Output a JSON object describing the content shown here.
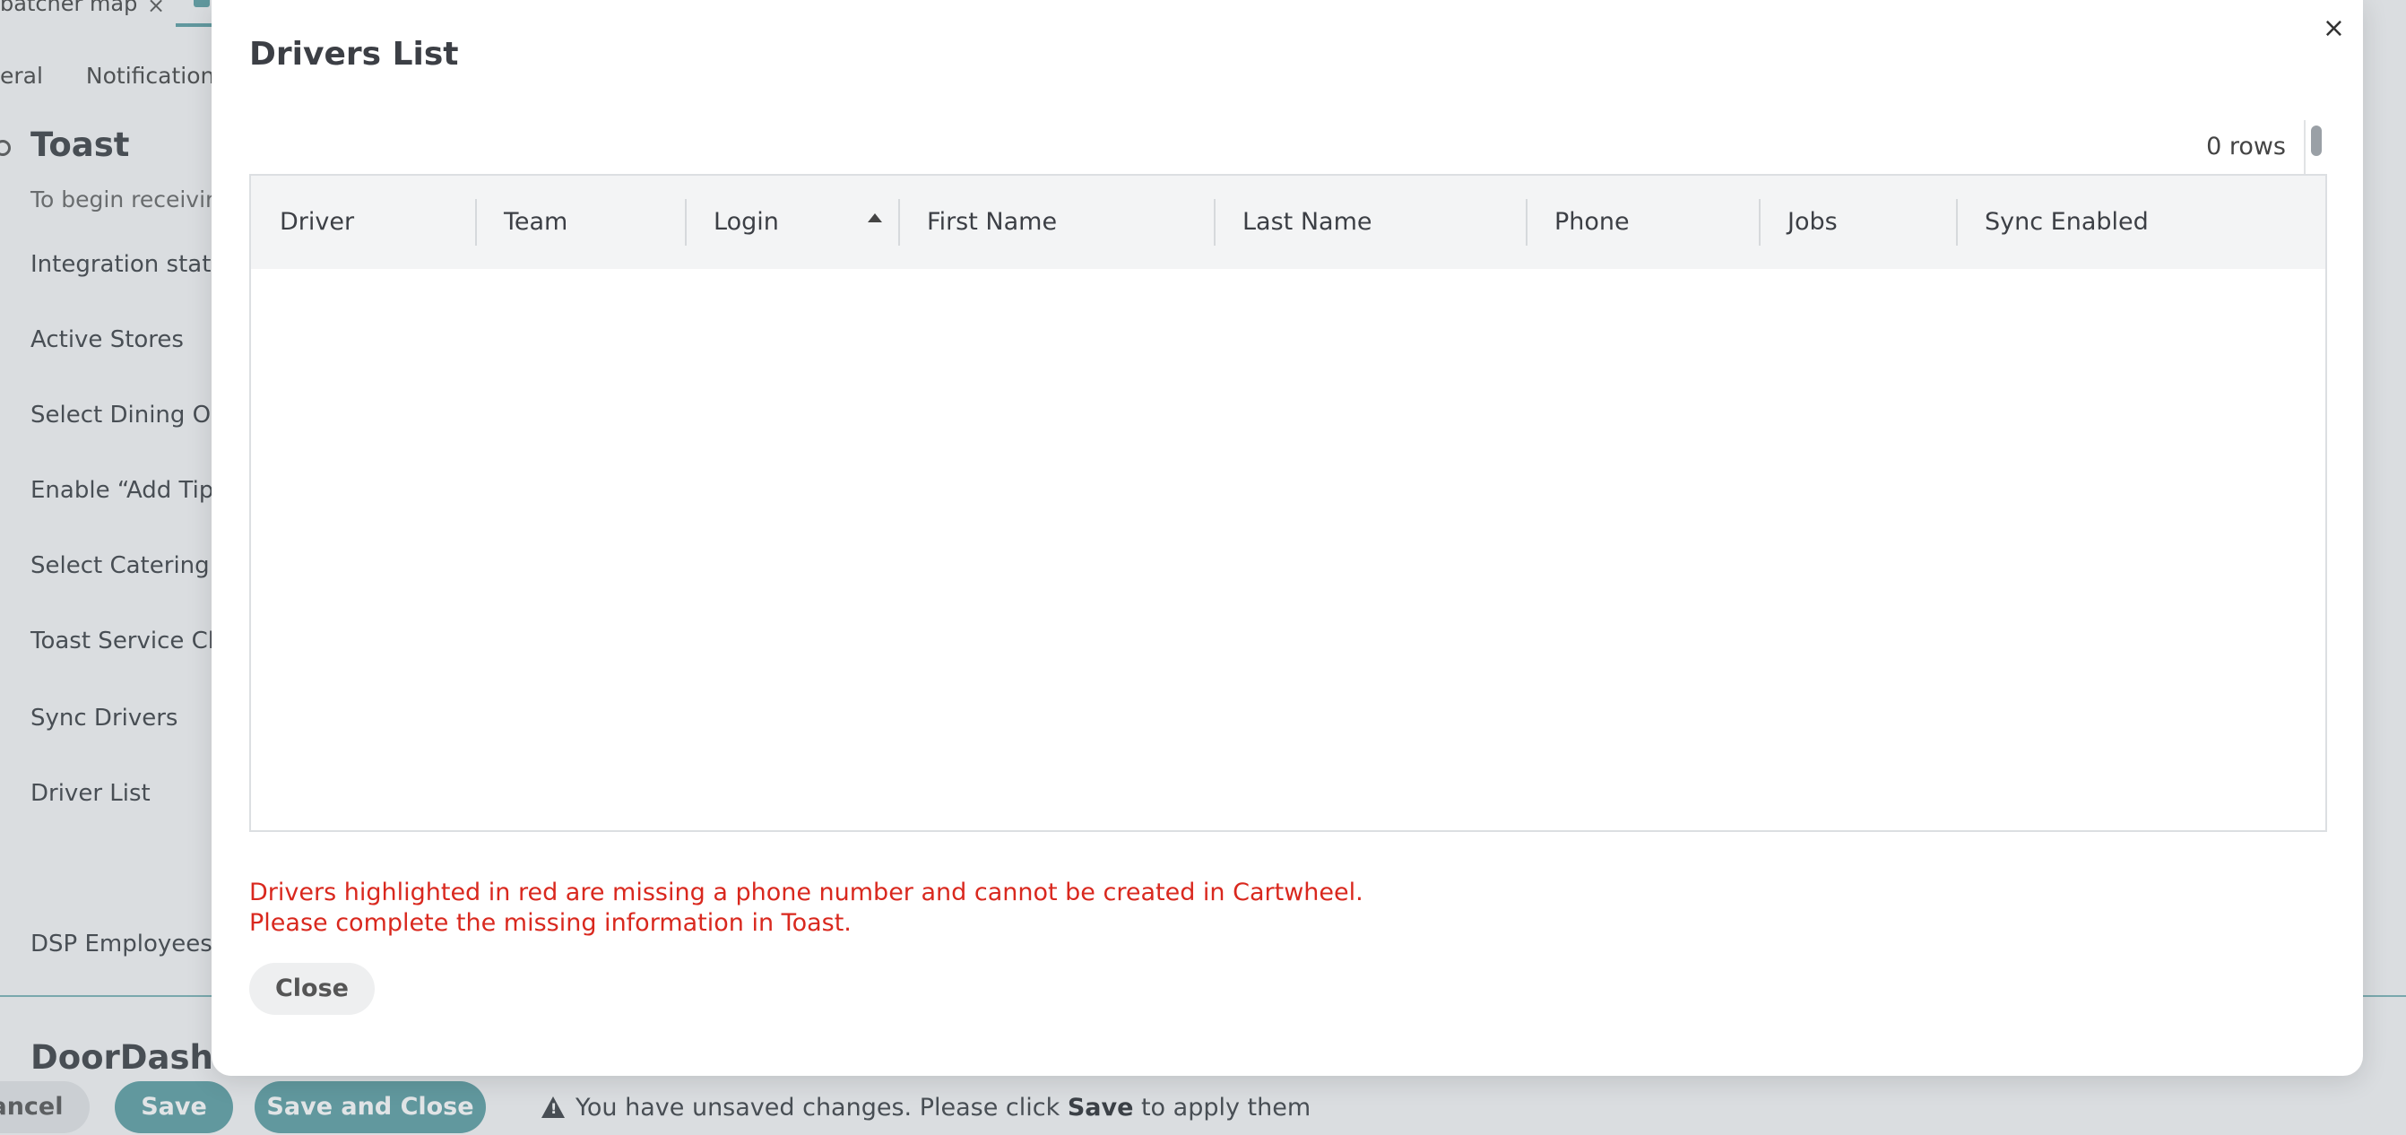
{
  "background": {
    "tab_text": "batcher map",
    "tab_close_glyph": "×",
    "subnav": [
      "eral",
      "Notifications"
    ],
    "section_title": "Toast",
    "section_desc": "To begin receivin",
    "settings": [
      "Integration statu",
      "Active Stores",
      "Select Dining Op",
      "Enable “Add Tip”",
      "Select Catering I",
      "Toast Service Ch",
      "Sync Drivers",
      "Driver List",
      "DSP Employees"
    ],
    "section2_title": "DoorDash D",
    "actions": {
      "cancel_label": "ancel",
      "save_label": "Save",
      "save_close_label": "Save and Close"
    },
    "unsaved": {
      "prefix": "You have unsaved changes. Please click ",
      "bold": "Save",
      "suffix": " to apply them"
    }
  },
  "modal": {
    "title": "Drivers List",
    "close_glyph": "×",
    "rows_label": "0 rows",
    "columns": [
      "Driver",
      "Team",
      "Login",
      "First Name",
      "Last Name",
      "Phone",
      "Jobs",
      "Sync Enabled"
    ],
    "sorted_column": "Login",
    "sort_direction": "ascending",
    "rows": [],
    "note_lines": [
      "Drivers highlighted in red are missing a phone number and cannot be created in Cartwheel.",
      "Please complete the missing information in Toast."
    ],
    "close_button_label": "Close"
  },
  "colors": {
    "accent": "#5b9ea3",
    "warning_text": "#d9281e",
    "header_bg": "#f3f4f5"
  }
}
